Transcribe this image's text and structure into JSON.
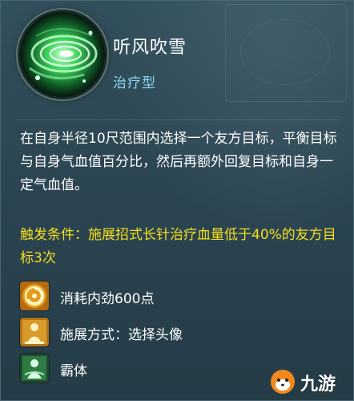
{
  "skill": {
    "name": "听风吹雪",
    "type": "治疗型",
    "icon": "green-wind-spiral-icon"
  },
  "description": "在自身半径10尺范围内选择一个友方目标，平衡目标与自身气血值百分比，然后再额外回复目标和自身一定气血值。",
  "trigger": "触发条件：施展招式长针治疗血量低于40%的友方目标3次",
  "attributes": [
    {
      "icon": "inner-force-swirl-icon",
      "label": "消耗内劲600点"
    },
    {
      "icon": "cast-method-figure-icon",
      "label": "施展方式：选择头像"
    },
    {
      "icon": "super-armor-figure-icon",
      "label": "霸体"
    }
  ],
  "watermark": {
    "text": "九游",
    "icon": "jiuyou-fox-logo"
  },
  "colors": {
    "title": "#ffffff",
    "type": "#8ed6f2",
    "trigger": "#f4df1e",
    "panel": "#2c4552"
  }
}
